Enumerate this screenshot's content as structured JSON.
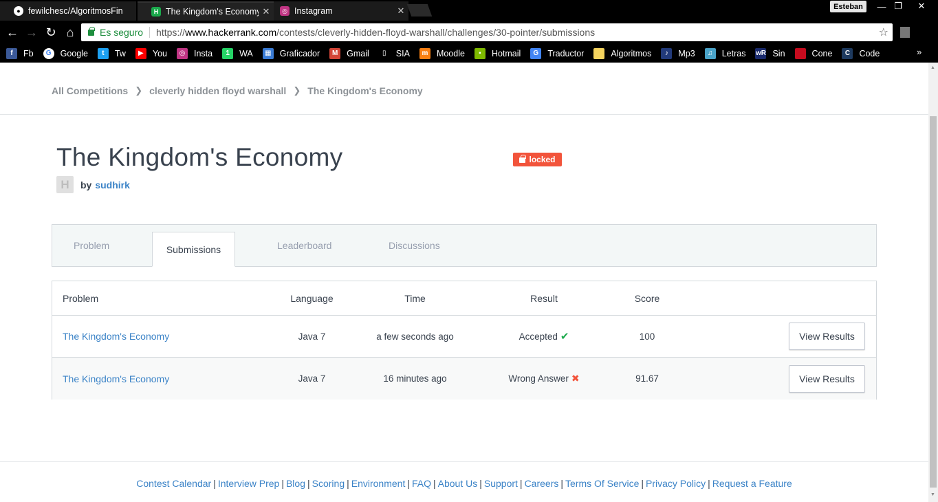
{
  "browser": {
    "tabs": [
      {
        "title": "fewilchesc/AlgoritmosFin",
        "icon": "github-icon"
      },
      {
        "title": "The Kingdom's Economy",
        "icon": "hackerrank-icon",
        "active": true
      },
      {
        "title": "Instagram",
        "icon": "instagram-icon"
      }
    ],
    "user": "Esteban",
    "secure_label": "Es seguro",
    "url_prefix": "https://",
    "url_host": "www.hackerrank.com",
    "url_path": "/contests/cleverly-hidden-floyd-warshall/challenges/30-pointer/submissions",
    "bookmarks": [
      {
        "label": "Fb",
        "icon": "facebook-icon",
        "color": "#3b5998",
        "glyph": "f"
      },
      {
        "label": "Google",
        "icon": "google-icon",
        "color": "#ffffff",
        "glyph": "G"
      },
      {
        "label": "Tw",
        "icon": "twitter-icon",
        "color": "#1da1f2",
        "glyph": "t"
      },
      {
        "label": "You",
        "icon": "youtube-icon",
        "color": "#ff0000",
        "glyph": "▶"
      },
      {
        "label": "Insta",
        "icon": "instagram-icon",
        "color": "#c13584",
        "glyph": "◎"
      },
      {
        "label": "WA",
        "icon": "whatsapp-icon",
        "color": "#25d366",
        "glyph": "1"
      },
      {
        "label": "Graficador",
        "icon": "graficador-icon",
        "color": "#3a7bd5",
        "glyph": "▦"
      },
      {
        "label": "Gmail",
        "icon": "gmail-icon",
        "color": "#d44638",
        "glyph": "M"
      },
      {
        "label": "SIA",
        "icon": "document-icon",
        "color": "#000000",
        "glyph": "▯"
      },
      {
        "label": "Moodle",
        "icon": "moodle-icon",
        "color": "#f98012",
        "glyph": "m"
      },
      {
        "label": "Hotmail",
        "icon": "microsoft-icon",
        "color": "#7fba00",
        "glyph": "▪"
      },
      {
        "label": "Traductor",
        "icon": "translate-icon",
        "color": "#4285f4",
        "glyph": "G"
      },
      {
        "label": "Algoritmos",
        "icon": "folder-icon",
        "color": "#f4d35e",
        "glyph": ""
      },
      {
        "label": "Mp3",
        "icon": "mp3-icon",
        "color": "#223a7a",
        "glyph": "♪"
      },
      {
        "label": "Letras",
        "icon": "letras-icon",
        "color": "#4aa3c8",
        "glyph": "♫"
      },
      {
        "label": "Sin",
        "icon": "wordreference-icon",
        "color": "#1a2a6c",
        "glyph": "wR"
      },
      {
        "label": "Cone",
        "icon": "spain-flag-icon",
        "color": "#c60b1e",
        "glyph": ""
      },
      {
        "label": "Code",
        "icon": "code-icon",
        "color": "#1e3a5f",
        "glyph": "C"
      }
    ]
  },
  "breadcrumb": [
    "All Competitions",
    "cleverly hidden floyd warshall",
    "The Kingdom's Economy"
  ],
  "challenge": {
    "title": "The Kingdom's Economy",
    "badge": "locked",
    "by_label": "by",
    "author": "sudhirk"
  },
  "tabs": [
    "Problem",
    "Submissions",
    "Leaderboard",
    "Discussions"
  ],
  "active_tab": "Submissions",
  "table": {
    "headers": [
      "Problem",
      "Language",
      "Time",
      "Result",
      "Score"
    ],
    "rows": [
      {
        "problem": "The Kingdom's Economy",
        "language": "Java 7",
        "time": "a few seconds ago",
        "result": "Accepted",
        "status": "accepted",
        "score": "100",
        "action": "View Results"
      },
      {
        "problem": "The Kingdom's Economy",
        "language": "Java 7",
        "time": "16 minutes ago",
        "result": "Wrong Answer",
        "status": "wrong",
        "score": "91.67",
        "action": "View Results"
      }
    ]
  },
  "footer": [
    "Contest Calendar",
    "Interview Prep",
    "Blog",
    "Scoring",
    "Environment",
    "FAQ",
    "About Us",
    "Support",
    "Careers",
    "Terms Of Service",
    "Privacy Policy",
    "Request a Feature"
  ],
  "colors": {
    "accent": "#3b83c7",
    "success": "#1ba94c",
    "danger": "#f2543b",
    "text": "#39424e"
  }
}
